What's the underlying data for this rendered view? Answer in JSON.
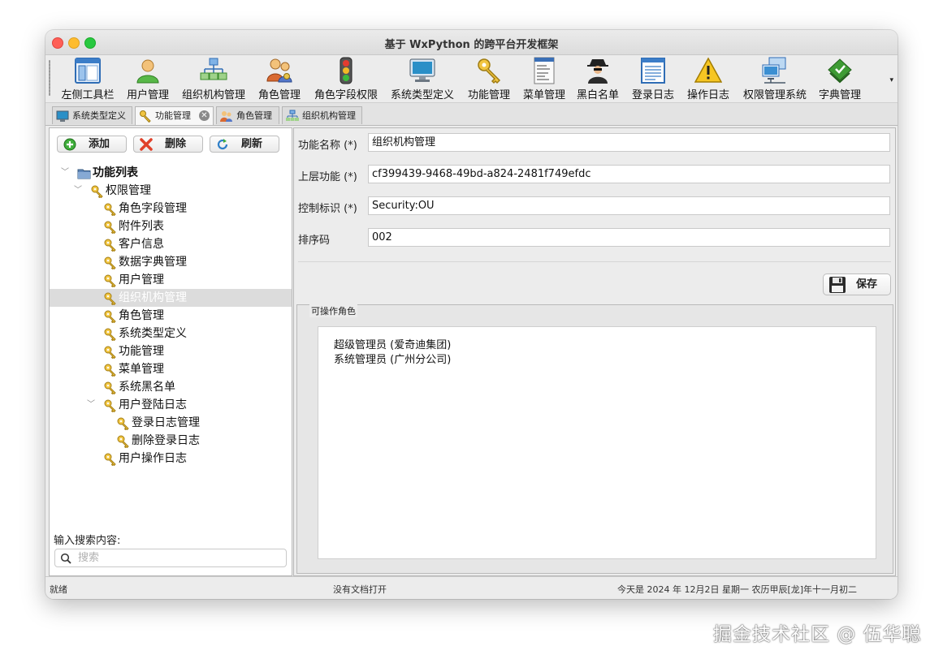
{
  "window": {
    "title": "基于 WxPython 的跨平台开发框架"
  },
  "toolbar": {
    "items": [
      {
        "label": "左侧工具栏",
        "icon": "window-layout-icon"
      },
      {
        "label": "用户管理",
        "icon": "user-icon"
      },
      {
        "label": "组织机构管理",
        "icon": "org-chart-icon"
      },
      {
        "label": "角色管理",
        "icon": "users-key-icon"
      },
      {
        "label": "角色字段权限",
        "icon": "traffic-light-icon"
      },
      {
        "label": "系统类型定义",
        "icon": "monitor-icon"
      },
      {
        "label": "功能管理",
        "icon": "keys-icon"
      },
      {
        "label": "菜单管理",
        "icon": "menu-list-icon"
      },
      {
        "label": "黑白名单",
        "icon": "spy-icon"
      },
      {
        "label": "登录日志",
        "icon": "log-document-icon"
      },
      {
        "label": "操作日志",
        "icon": "warning-icon"
      },
      {
        "label": "权限管理系统",
        "icon": "network-computers-icon"
      },
      {
        "label": "字典管理",
        "icon": "green-book-icon"
      }
    ],
    "overflow": "▾"
  },
  "tabs": [
    {
      "label": "系统类型定义",
      "icon": "monitor-icon"
    },
    {
      "label": "功能管理",
      "icon": "keys-icon",
      "active": true,
      "close": "✕"
    },
    {
      "label": "角色管理",
      "icon": "users-icon"
    },
    {
      "label": "组织机构管理",
      "icon": "org-chart-icon"
    }
  ],
  "left": {
    "buttons": {
      "add": "添加",
      "delete": "删除",
      "refresh": "刷新"
    },
    "tree": [
      {
        "label": "功能列表",
        "level": 0,
        "expanded": true,
        "icon": "folder-icon",
        "bold": true
      },
      {
        "label": "权限管理",
        "level": 1,
        "expanded": true,
        "icon": "keys-icon"
      },
      {
        "label": "角色字段管理",
        "level": 2,
        "icon": "keys-icon"
      },
      {
        "label": "附件列表",
        "level": 2,
        "icon": "keys-icon"
      },
      {
        "label": "客户信息",
        "level": 2,
        "icon": "keys-icon"
      },
      {
        "label": "数据字典管理",
        "level": 2,
        "icon": "keys-icon"
      },
      {
        "label": "用户管理",
        "level": 2,
        "icon": "keys-icon"
      },
      {
        "label": "组织机构管理",
        "level": 2,
        "icon": "keys-icon",
        "selected": true
      },
      {
        "label": "角色管理",
        "level": 2,
        "icon": "keys-icon"
      },
      {
        "label": "系统类型定义",
        "level": 2,
        "icon": "keys-icon"
      },
      {
        "label": "功能管理",
        "level": 2,
        "icon": "keys-icon"
      },
      {
        "label": "菜单管理",
        "level": 2,
        "icon": "keys-icon"
      },
      {
        "label": "系统黑名单",
        "level": 2,
        "icon": "keys-icon"
      },
      {
        "label": "用户登陆日志",
        "level": 2,
        "expanded": true,
        "icon": "keys-icon"
      },
      {
        "label": "登录日志管理",
        "level": 3,
        "icon": "keys-icon"
      },
      {
        "label": "删除登录日志",
        "level": 3,
        "icon": "keys-icon"
      },
      {
        "label": "用户操作日志",
        "level": 2,
        "icon": "keys-icon"
      }
    ],
    "search_label": "输入搜索内容:",
    "search_placeholder": "搜索"
  },
  "form": {
    "fields": [
      {
        "label": "功能名称 (*)",
        "value": "组织机构管理"
      },
      {
        "label": "上层功能 (*)",
        "value": "cf399439-9468-49bd-a824-2481f749efdc"
      },
      {
        "label": "控制标识 (*)",
        "value": "Security:OU"
      },
      {
        "label": "排序码",
        "value": "002"
      }
    ],
    "save_label": "保存",
    "roles_title": "可操作角色",
    "roles": [
      "超级管理员 (爱奇迪集团)",
      "系统管理员 (广州分公司)"
    ]
  },
  "status": {
    "left": "就绪",
    "center": "没有文档打开",
    "right": "今天是 2024 年 12月2日 星期一 农历甲辰[龙]年十一月初二"
  },
  "watermark": "掘金技术社区 @ 伍华聪"
}
